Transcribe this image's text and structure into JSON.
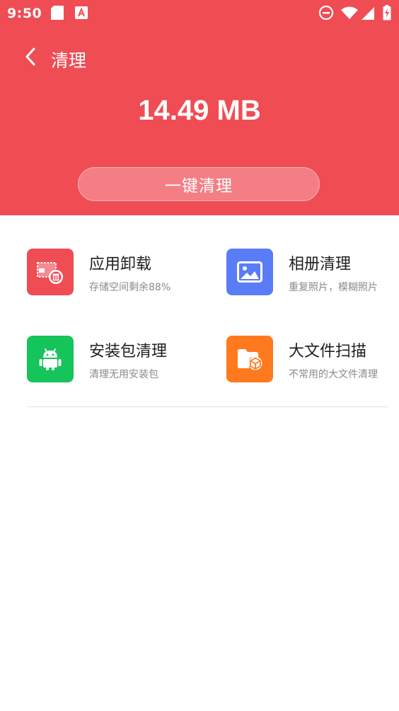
{
  "status_bar": {
    "time": "9:50",
    "icons": [
      "sd-card-icon",
      "app-notification-icon",
      "do-not-disturb-icon",
      "wifi-icon",
      "signal-icon",
      "battery-charging-icon"
    ]
  },
  "header": {
    "title": "清理",
    "back_icon": "back-arrow-icon"
  },
  "summary": {
    "size": "14.49 MB",
    "clean_button_label": "一键清理"
  },
  "features": [
    {
      "title": "应用卸载",
      "subtitle": "存储空间剩余88%",
      "icon": "app-uninstall-icon",
      "color": "#f04c54"
    },
    {
      "title": "相册清理",
      "subtitle": "重复照片，模糊照片",
      "icon": "photo-album-icon",
      "color": "#5b7cf7"
    },
    {
      "title": "安装包清理",
      "subtitle": "清理无用安装包",
      "icon": "android-package-icon",
      "color": "#16c45c"
    },
    {
      "title": "大文件扫描",
      "subtitle": "不常用的大文件清理",
      "icon": "large-file-icon",
      "color": "#ff7a1f"
    }
  ],
  "colors": {
    "hero_background": "#f04c54",
    "button_background": "#f37f84"
  }
}
